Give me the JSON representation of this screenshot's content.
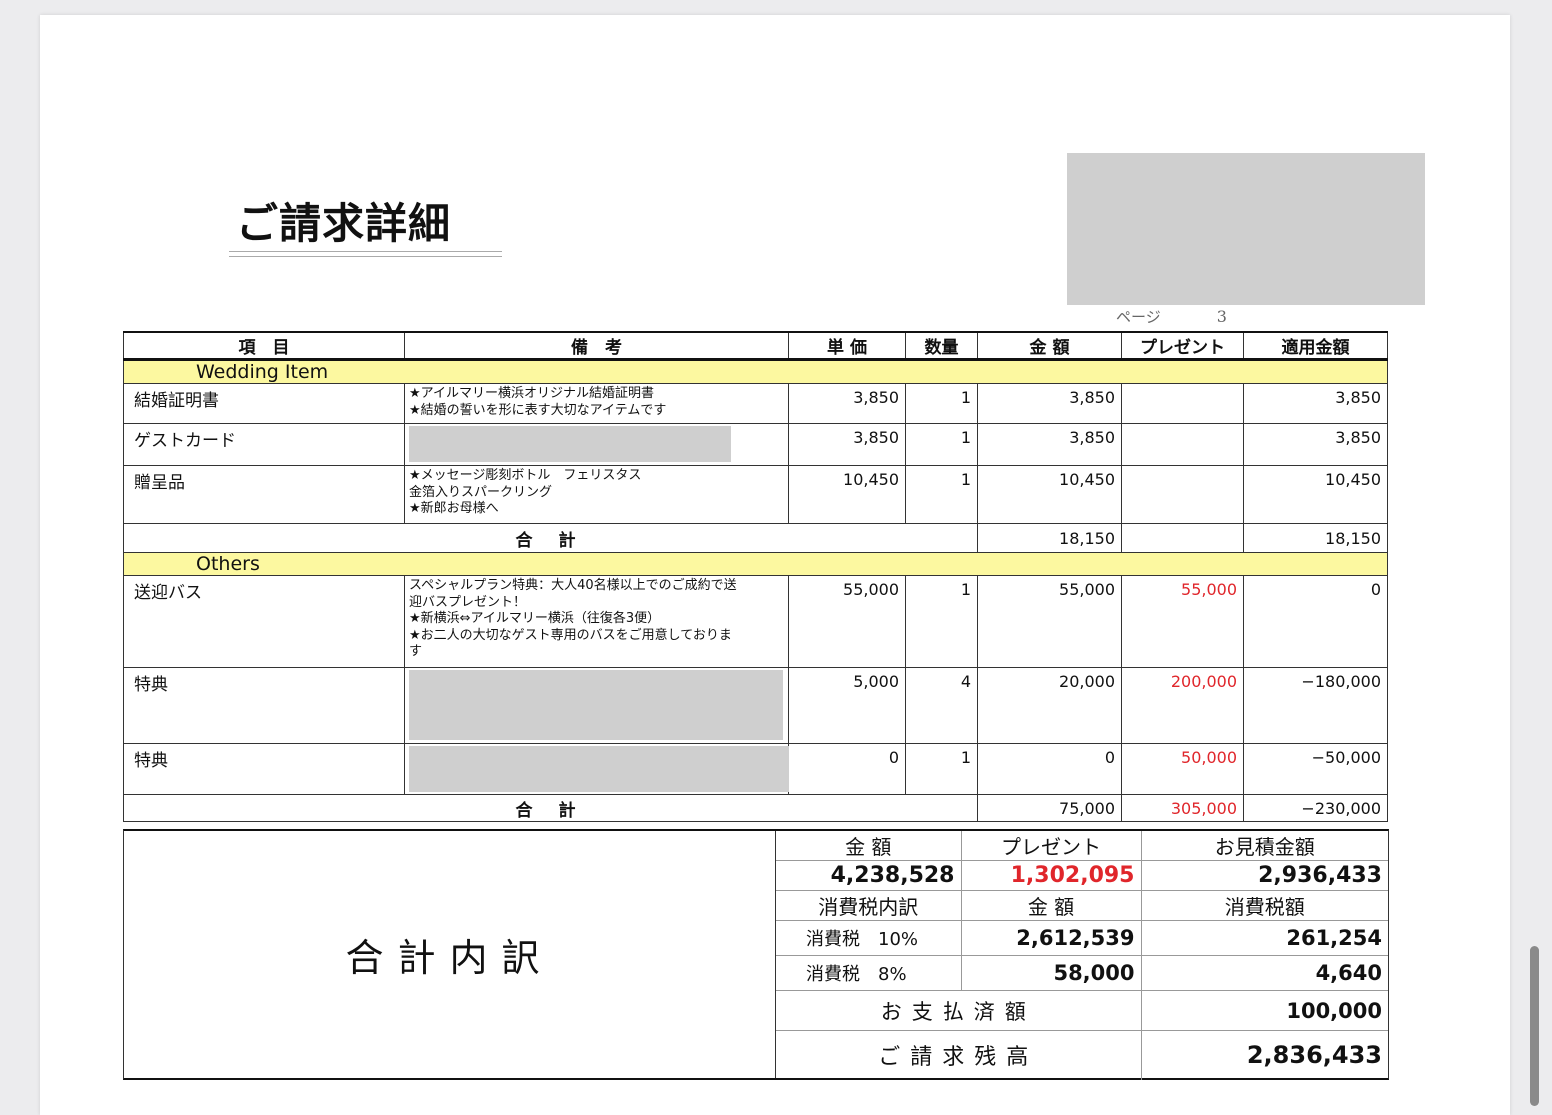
{
  "title": "ご請求詳細",
  "page": {
    "label": "ページ",
    "number": "3"
  },
  "headers": {
    "item": "項　目",
    "remark": "備　考",
    "unit": "単 価",
    "qty": "数量",
    "amount": "金 額",
    "present": "プレゼント",
    "applied": "適用金額"
  },
  "sections": [
    {
      "name": "Wedding Item",
      "rows": [
        {
          "item": "結婚証明書",
          "remark": [
            "★アイルマリー横浜オリジナル結婚証明書",
            "★結婚の誓いを形に表す大切なアイテムです"
          ],
          "unit": "3,850",
          "qty": "1",
          "amount": "3,850",
          "present": "",
          "applied": "3,850"
        },
        {
          "item": "ゲストカード",
          "remark": [],
          "unit": "3,850",
          "qty": "1",
          "amount": "3,850",
          "present": "",
          "applied": "3,850"
        },
        {
          "item": "贈呈品",
          "remark": [
            "★メッセージ彫刻ボトル　フェリスタス",
            "金箔入りスパークリング",
            "★新郎お母様へ"
          ],
          "unit": "10,450",
          "qty": "1",
          "amount": "10,450",
          "present": "",
          "applied": "10,450"
        }
      ],
      "subtotal": {
        "label": "合 計",
        "amount": "18,150",
        "present": "",
        "applied": "18,150"
      }
    },
    {
      "name": "Others",
      "rows": [
        {
          "item": "送迎バス",
          "remark": [
            "スペシャルプラン特典：大人40名様以上でのご成約で送",
            "迎バスプレゼント！",
            "★新横浜⇔アイルマリー横浜（往復各3便）",
            "★お二人の大切なゲスト専用のバスをご用意しておりま",
            "す"
          ],
          "unit": "55,000",
          "qty": "1",
          "amount": "55,000",
          "present": "55,000",
          "applied": "0"
        },
        {
          "item": "特典",
          "remark": [],
          "unit": "5,000",
          "qty": "4",
          "amount": "20,000",
          "present": "200,000",
          "applied": "−180,000"
        },
        {
          "item": "特典",
          "remark": [],
          "unit": "0",
          "qty": "1",
          "amount": "0",
          "present": "50,000",
          "applied": "−50,000"
        }
      ],
      "subtotal": {
        "label": "合 計",
        "amount": "75,000",
        "present": "305,000",
        "applied": "−230,000"
      }
    }
  ],
  "summary": {
    "label": "合計内訳",
    "col_amount": "金 額",
    "col_present": "プレゼント",
    "col_estimate": "お見積金額",
    "amount": "4,238,528",
    "present": "1,302,095",
    "estimate": "2,936,433",
    "tax_breakdown_label": "消費税内訳",
    "tax_amount_label": "金 額",
    "tax_total_label": "消費税額",
    "tax10_label": "消費税　10%",
    "tax10_base": "2,612,539",
    "tax10_tax": "261,254",
    "tax8_label": "消費税　8%",
    "tax8_base": "58,000",
    "tax8_tax": "4,640",
    "paid_label": "お支払済額",
    "paid": "100,000",
    "balance_label": "ご請求残高",
    "balance": "2,836,433"
  },
  "colors": {
    "section_bg": "#fcf8a0",
    "present_red": "#e0262b"
  }
}
